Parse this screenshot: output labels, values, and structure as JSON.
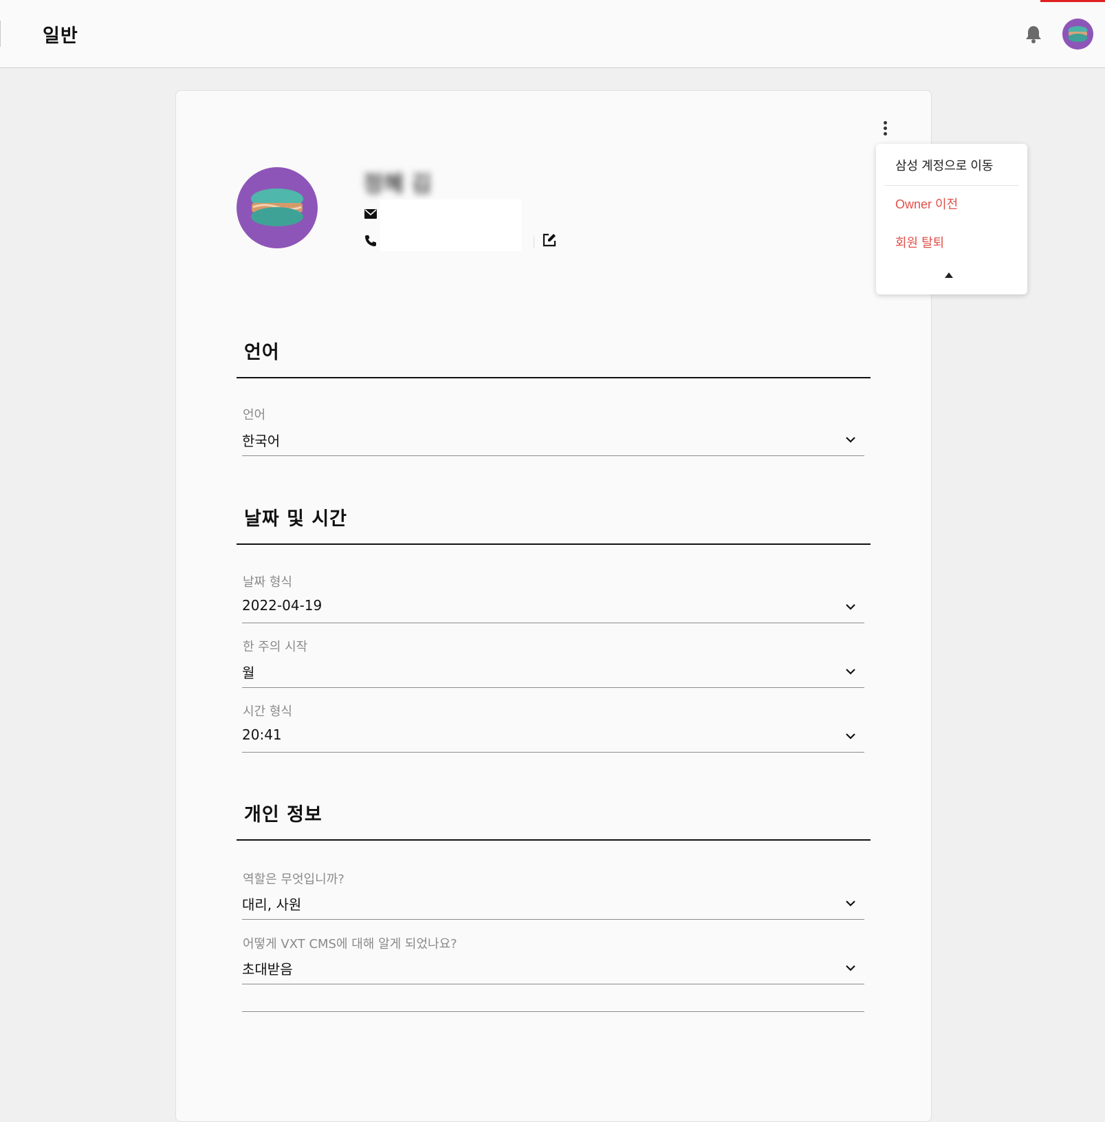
{
  "header": {
    "title": "일반"
  },
  "menu": {
    "items": [
      "삼성 계정으로 이동",
      "Owner 이전",
      "회원 탈퇴"
    ]
  },
  "profile": {
    "name": "정혜 김"
  },
  "sections": {
    "language": {
      "title": "언어",
      "fields": [
        {
          "label": "언어",
          "value": "한국어"
        }
      ]
    },
    "datetime": {
      "title": "날짜 및 시간",
      "fields": [
        {
          "label": "날짜 형식",
          "value": "2022-04-19"
        },
        {
          "label": "한 주의 시작",
          "value": "월"
        },
        {
          "label": "시간 형식",
          "value": "20:41"
        }
      ]
    },
    "personal": {
      "title": "개인 정보",
      "fields": [
        {
          "label": "역할은 무엇입니까?",
          "value": "대리, 사원"
        },
        {
          "label": "어떻게 VXT CMS에 대해 알게 되었나요?",
          "value": "초대받음"
        }
      ]
    }
  },
  "colors": {
    "accent_red": "#e0504a",
    "avatar_bg": "#8e55b8"
  },
  "icons": [
    "bell-icon",
    "avatar",
    "kebab-menu-icon",
    "mail-icon",
    "phone-icon",
    "edit-icon",
    "chevron-down-icon",
    "chevron-up-icon"
  ]
}
